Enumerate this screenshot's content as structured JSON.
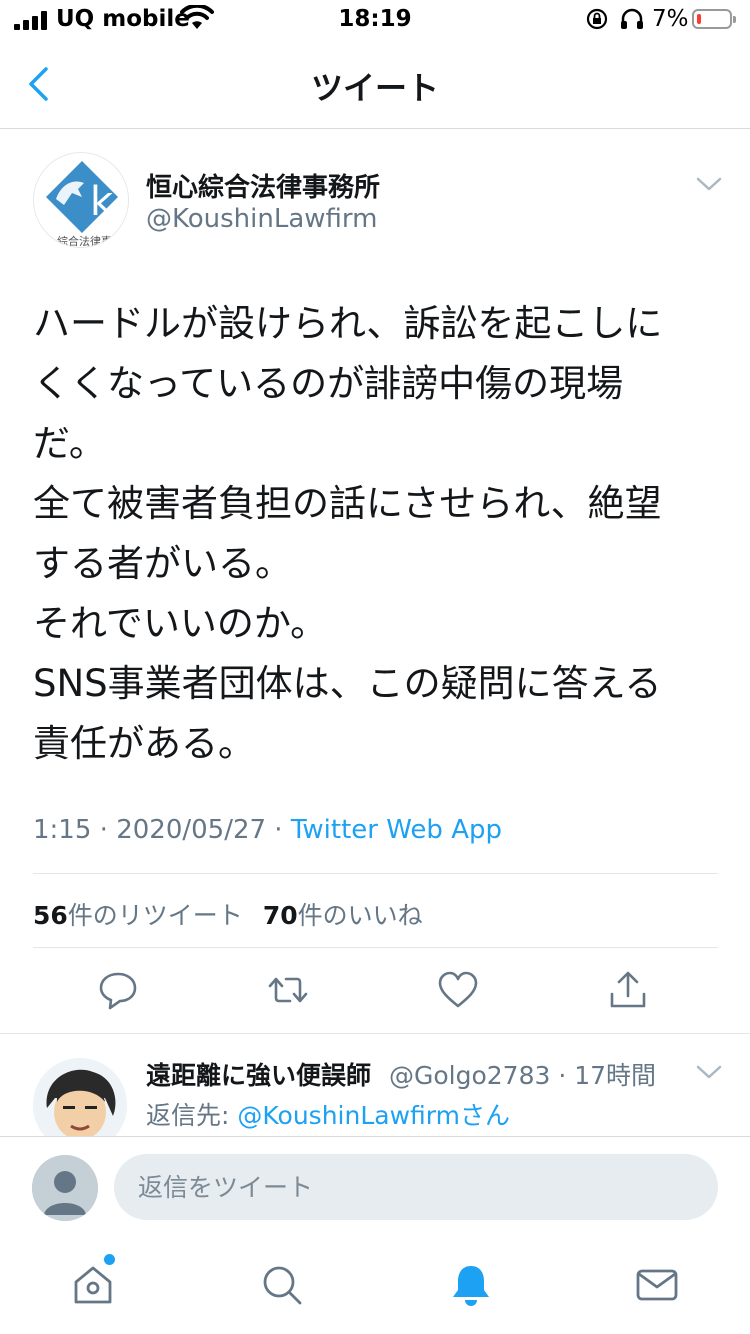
{
  "status_bar": {
    "carrier": "UQ mobile",
    "time": "18:19",
    "battery_percent": "7%",
    "battery_level": 0.07
  },
  "nav": {
    "title": "ツイート",
    "back_icon": "chevron-left-icon"
  },
  "tweet": {
    "author_name": "恒心綜合法律事務所",
    "author_handle": "@KoushinLawfirm",
    "text_lines": [
      "ハードルが設けられ、訴訟を起こしに",
      "くくなっているのが誹謗中傷の現場",
      "だ。",
      "全て被害者負担の話にさせられ、絶望",
      "する者がいる。",
      "それでいいのか。",
      "SNS事業者団体は、この疑問に答える",
      "責任がある。"
    ],
    "time": "1:15",
    "date": "2020/05/27",
    "source": "Twitter Web App",
    "separator": " · ",
    "retweet_count": "56",
    "retweet_label": "件のリツイート",
    "like_count": "70",
    "like_label": "件のいいね",
    "actions": [
      "reply-icon",
      "retweet-icon",
      "like-icon",
      "share-icon"
    ]
  },
  "reply": {
    "author_name": "遠距離に強い便誤師",
    "author_handle": "@Golgo2783",
    "time_ago": "17時間",
    "reply_to_label": "返信先: ",
    "reply_to_handle": "@KoushinLawfirm",
    "reply_to_suffix": "さん"
  },
  "composer": {
    "placeholder": "返信をツイート"
  },
  "tab_bar": {
    "tabs": [
      "home-icon",
      "search-icon",
      "notifications-icon",
      "messages-icon"
    ],
    "active": "notifications-icon"
  },
  "colors": {
    "accent": "#1da1f2",
    "text": "#14171a",
    "secondary": "#657786"
  }
}
